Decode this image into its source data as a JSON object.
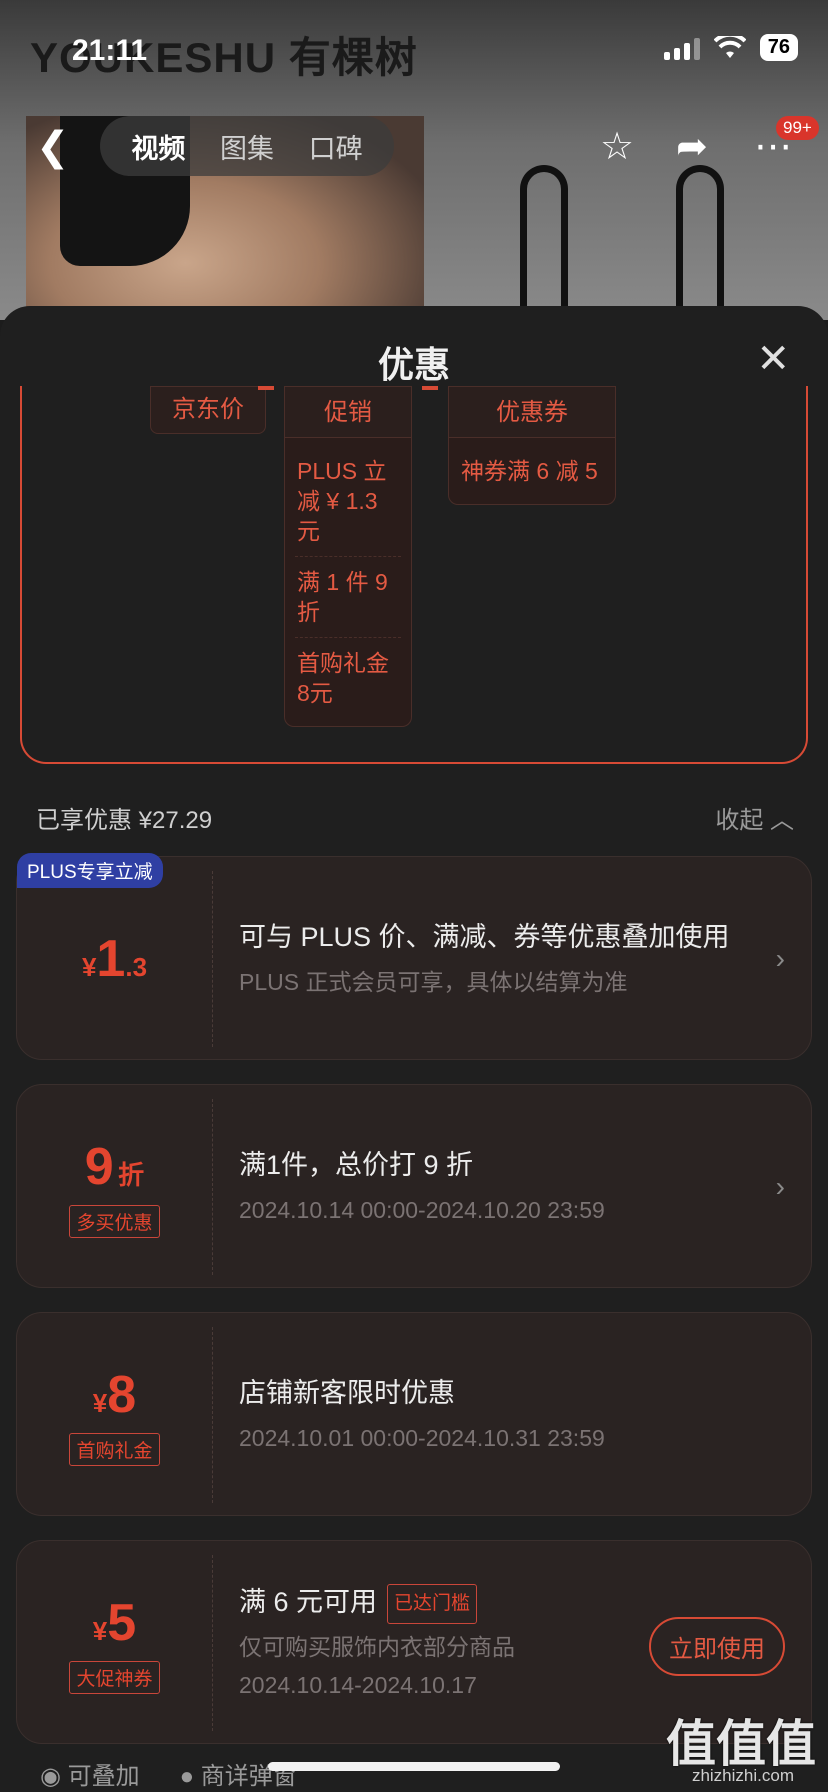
{
  "status_bar": {
    "time": "21:11",
    "battery": "76"
  },
  "brand": "YOUKESHU 有棵树",
  "nav": {
    "tabs": [
      "视频",
      "图集",
      "口碑"
    ],
    "badge": "99+"
  },
  "sheet": {
    "title": "优惠",
    "diagram": {
      "jd_price": "京东价",
      "promotion": {
        "label": "促销",
        "items": [
          "PLUS 立减 ¥ 1.3元",
          "满 1 件 9 折",
          "首购礼金 8元"
        ]
      },
      "coupon": {
        "label": "优惠券",
        "items": [
          "神券满 6 减 5"
        ]
      }
    },
    "enjoyed": "已享优惠 ¥27.29",
    "collapse": "收起",
    "cards": [
      {
        "badge": "PLUS专享立减",
        "currency": "¥",
        "amount_big": "1",
        "amount_small": ".3",
        "title": "可与 PLUS 价、满减、券等优惠叠加使用",
        "sub": "PLUS 正式会员可享，具体以结算为准"
      },
      {
        "amount_big": "9",
        "unit": "折",
        "tag": "多买优惠",
        "title": "满1件，总价打 9 折",
        "sub": "2024.10.14 00:00-2024.10.20 23:59"
      },
      {
        "currency": "¥",
        "amount_big": "8",
        "tag": "首购礼金",
        "title": "店铺新客限时优惠",
        "sub": "2024.10.01 00:00-2024.10.31 23:59"
      },
      {
        "currency": "¥",
        "amount_big": "5",
        "tag": "大促神券",
        "title": "满 6 元可用",
        "reached": "已达门槛",
        "sub": "仅可购买服饰内衣部分商品",
        "sub2": "2024.10.14-2024.10.17",
        "button": "立即使用"
      }
    ],
    "bottom_options": [
      "可叠加",
      "商详弹窗"
    ]
  },
  "watermark": {
    "logo": "值值值",
    "url": "zhizhizhi.com"
  }
}
